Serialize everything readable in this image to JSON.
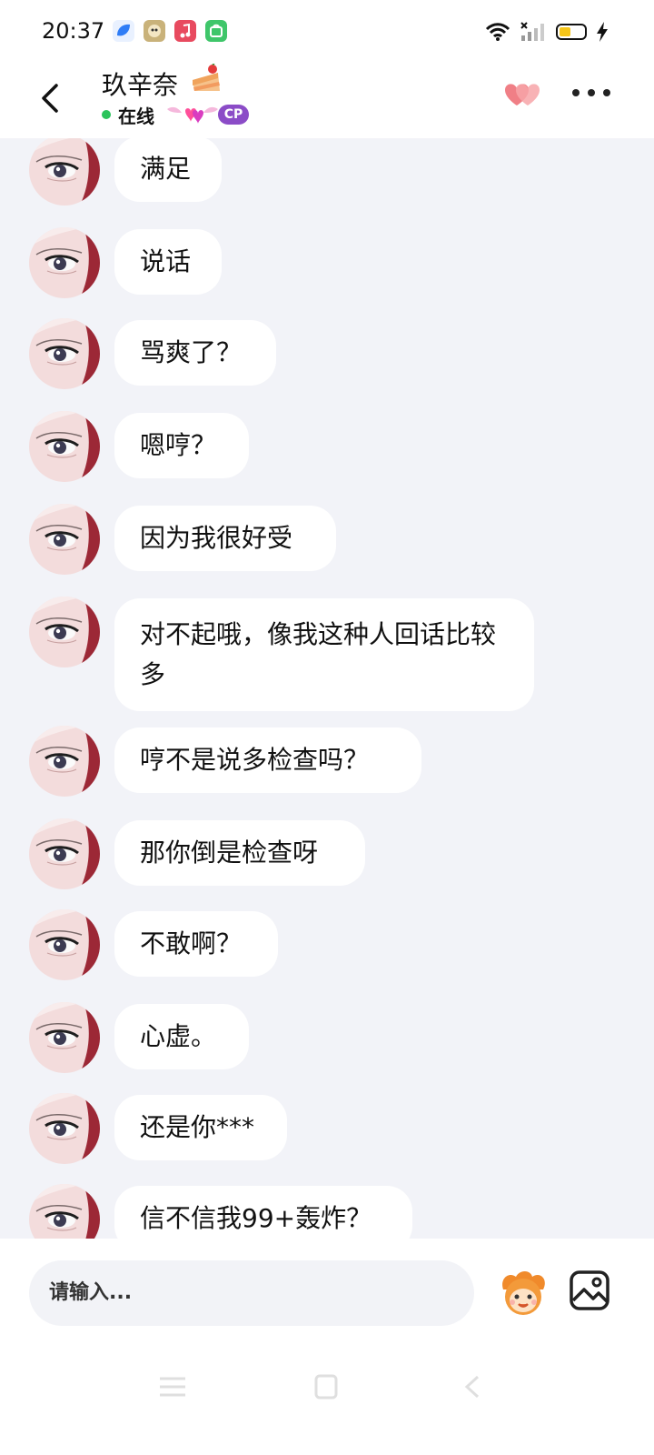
{
  "status_bar": {
    "time": "20:37",
    "icons": [
      "app-icon-blue-leaf",
      "app-icon-game",
      "app-icon-music",
      "app-icon-shopping"
    ],
    "right_icons": [
      "wifi-icon",
      "signal-icon",
      "battery-icon",
      "charging-icon"
    ],
    "battery_level": 0.35
  },
  "header": {
    "title": "玖辛奈",
    "status_text": "在线",
    "cp_tag": "CP",
    "colors": {
      "online_dot": "#2bc35b",
      "cp_tag": "#8b4cc7",
      "heart": "#f07f86"
    }
  },
  "messages": [
    {
      "text": "满足"
    },
    {
      "text": "说话"
    },
    {
      "text": "骂爽了？"
    },
    {
      "text": "嗯哼？"
    },
    {
      "text": "因为我很好受"
    },
    {
      "text": "对不起哦，像我这种人回话比较多"
    },
    {
      "text": "哼不是说多检查吗？"
    },
    {
      "text": "那你倒是检查呀"
    },
    {
      "text": "不敢啊？"
    },
    {
      "text": "心虚。"
    },
    {
      "text": "还是你***"
    },
    {
      "text": "信不信我99+轰炸？"
    }
  ],
  "input": {
    "placeholder": "请输入..."
  }
}
